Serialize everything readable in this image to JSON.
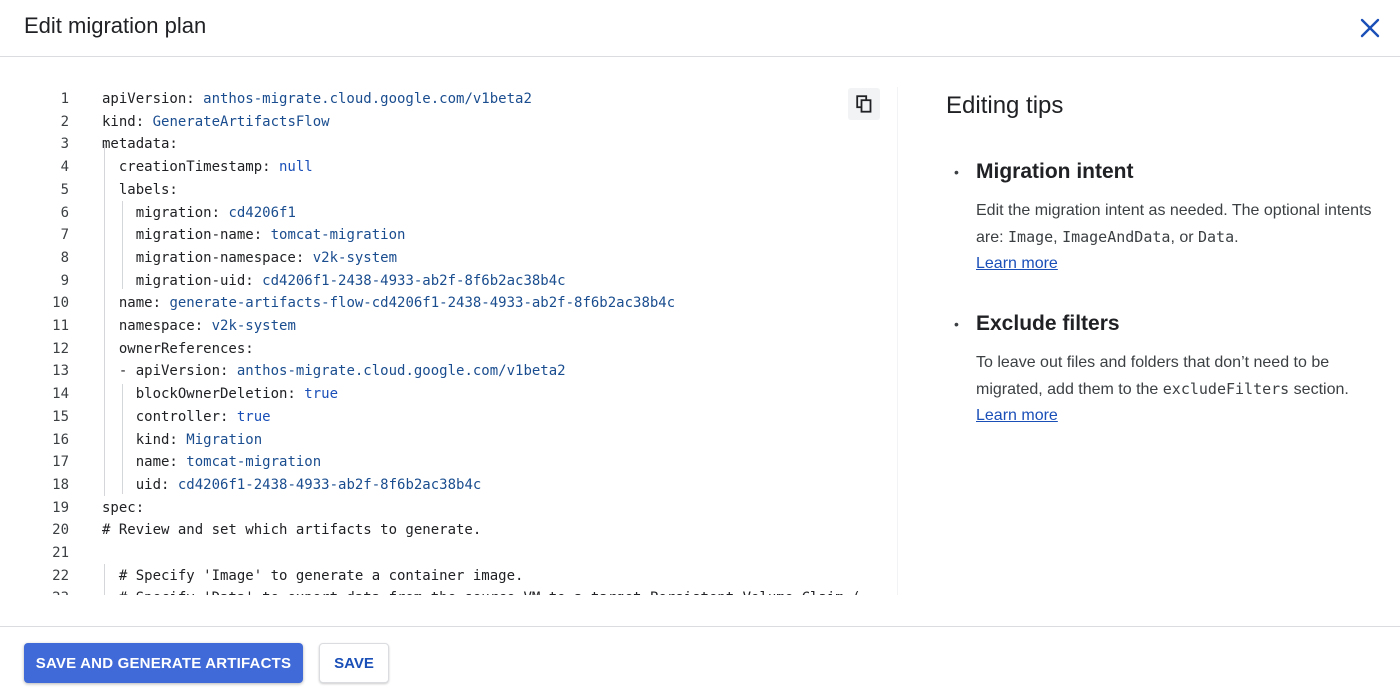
{
  "dialog": {
    "title": "Edit migration plan",
    "close_icon": "close-icon"
  },
  "editor": {
    "copy_icon": "copy-icon",
    "lines": [
      {
        "num": "1",
        "indent": "",
        "key": "apiVersion:",
        "value": " anthos-migrate.cloud.google.com/v1beta2",
        "vclass": "val"
      },
      {
        "num": "2",
        "indent": "",
        "key": "kind:",
        "value": " GenerateArtifactsFlow",
        "vclass": "val"
      },
      {
        "num": "3",
        "indent": "",
        "key": "metadata:",
        "value": "",
        "vclass": "val"
      },
      {
        "num": "4",
        "indent": "  ",
        "key": "creationTimestamp:",
        "value": " null",
        "vclass": "kw"
      },
      {
        "num": "5",
        "indent": "  ",
        "key": "labels:",
        "value": "",
        "vclass": "val"
      },
      {
        "num": "6",
        "indent": "    ",
        "key": "migration:",
        "value": " cd4206f1",
        "vclass": "val"
      },
      {
        "num": "7",
        "indent": "    ",
        "key": "migration-name:",
        "value": " tomcat-migration",
        "vclass": "val"
      },
      {
        "num": "8",
        "indent": "    ",
        "key": "migration-namespace:",
        "value": " v2k-system",
        "vclass": "val"
      },
      {
        "num": "9",
        "indent": "    ",
        "key": "migration-uid:",
        "value": " cd4206f1-2438-4933-ab2f-8f6b2ac38b4c",
        "vclass": "val"
      },
      {
        "num": "10",
        "indent": "  ",
        "key": "name:",
        "value": " generate-artifacts-flow-cd4206f1-2438-4933-ab2f-8f6b2ac38b4c",
        "vclass": "val"
      },
      {
        "num": "11",
        "indent": "  ",
        "key": "namespace:",
        "value": " v2k-system",
        "vclass": "val"
      },
      {
        "num": "12",
        "indent": "  ",
        "key": "ownerReferences:",
        "value": "",
        "vclass": "val"
      },
      {
        "num": "13",
        "indent": "  ",
        "key": "- apiVersion:",
        "value": " anthos-migrate.cloud.google.com/v1beta2",
        "vclass": "val"
      },
      {
        "num": "14",
        "indent": "    ",
        "key": "blockOwnerDeletion:",
        "value": " true",
        "vclass": "kw"
      },
      {
        "num": "15",
        "indent": "    ",
        "key": "controller:",
        "value": " true",
        "vclass": "kw"
      },
      {
        "num": "16",
        "indent": "    ",
        "key": "kind:",
        "value": " Migration",
        "vclass": "val"
      },
      {
        "num": "17",
        "indent": "    ",
        "key": "name:",
        "value": " tomcat-migration",
        "vclass": "val"
      },
      {
        "num": "18",
        "indent": "    ",
        "key": "uid:",
        "value": " cd4206f1-2438-4933-ab2f-8f6b2ac38b4c",
        "vclass": "val"
      },
      {
        "num": "19",
        "indent": "",
        "key": "spec:",
        "value": "",
        "vclass": "val"
      },
      {
        "num": "20",
        "indent": "",
        "key": "# Review and set which artifacts to generate.",
        "value": "",
        "vclass": "val"
      },
      {
        "num": "21",
        "indent": "",
        "key": "",
        "value": "",
        "vclass": "val"
      },
      {
        "num": "22",
        "indent": "  ",
        "key": "# Specify 'Image' to generate a container image.",
        "value": "",
        "vclass": "val"
      },
      {
        "num": "23",
        "indent": "  ",
        "key": "# Specify 'Data' to export data from the source VM to a target Persistent Volume Claim (",
        "value": "",
        "vclass": "val"
      }
    ]
  },
  "tips": {
    "title": "Editing tips",
    "items": [
      {
        "heading": "Migration intent",
        "text_before": "Edit the migration intent as needed. The optional intents are: ",
        "code1": "Image",
        "sep1": ", ",
        "code2": "ImageAndData",
        "sep2": ", or ",
        "code3": "Data",
        "text_after": ".",
        "link": "Learn more"
      },
      {
        "heading": "Exclude filters",
        "text_before": "To leave out files and folders that don’t need to be migrated, add them to the ",
        "code1": "excludeFilters",
        "text_after": " section.",
        "link": "Learn more"
      }
    ]
  },
  "footer": {
    "primary_label": "SAVE AND GENERATE ARTIFACTS",
    "secondary_label": "SAVE"
  }
}
